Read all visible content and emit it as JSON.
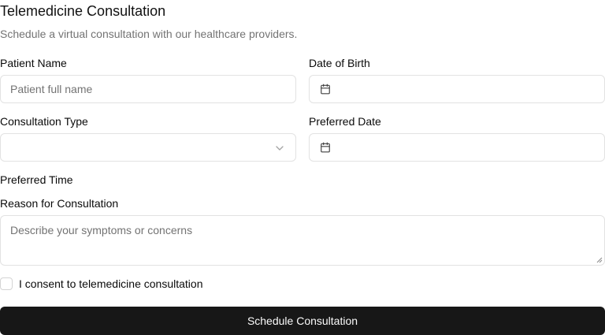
{
  "form": {
    "title": "Telemedicine Consultation",
    "subtitle": "Schedule a virtual consultation with our healthcare providers.",
    "patient_name": {
      "label": "Patient Name",
      "placeholder": "Patient full name",
      "value": ""
    },
    "date_of_birth": {
      "label": "Date of Birth",
      "value": "",
      "icon": "calendar-icon"
    },
    "consultation_type": {
      "label": "Consultation Type",
      "selected": "",
      "icon": "chevron-down-icon"
    },
    "preferred_date": {
      "label": "Preferred Date",
      "value": "",
      "icon": "calendar-icon"
    },
    "preferred_time": {
      "label": "Preferred Time"
    },
    "reason": {
      "label": "Reason for Consultation",
      "placeholder": "Describe your symptoms or concerns",
      "value": ""
    },
    "consent": {
      "label": "I consent to telemedicine consultation",
      "checked": false
    },
    "submit_label": "Schedule Consultation"
  },
  "colors": {
    "primary_button": "#171717",
    "primary_button_text": "#fafafa",
    "muted_text": "#737373",
    "border": "#e2e2e2"
  }
}
